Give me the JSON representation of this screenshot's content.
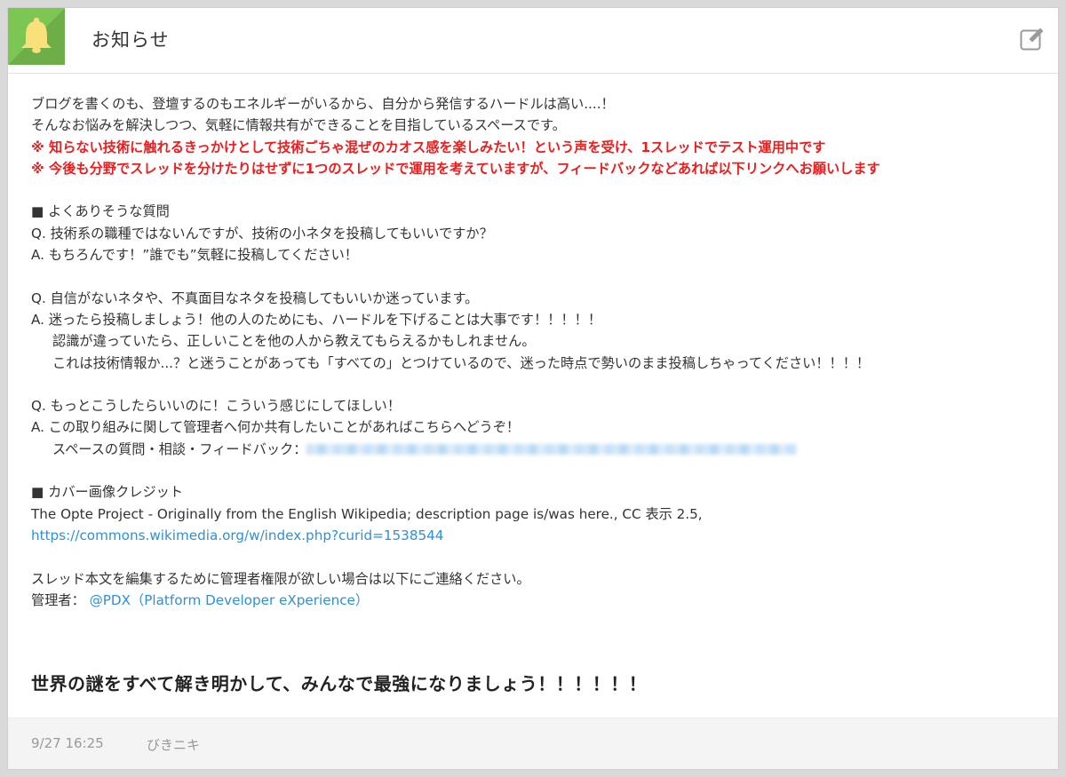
{
  "header": {
    "icon": "bell-icon",
    "accent_color": "#7cc653",
    "title": "お知らせ",
    "edit_icon": "edit-icon"
  },
  "body": {
    "intro_1": "ブログを書くのも、登壇するのもエネルギーがいるから、自分から発信するハードルは高い....！",
    "intro_2": "そんなお悩みを解決しつつ、気軽に情報共有ができることを目指しているスペースです。",
    "notice_1": "※ 知らない技術に触れるきっかけとして技術ごちゃ混ぜのカオス感を楽しみたい！という声を受け、1スレッドでテスト運用中です",
    "notice_2": "※ 今後も分野でスレッドを分けたりはせずに1つのスレッドで運用を考えていますが、フィードバックなどあれば以下リンクへお願いします",
    "faq_heading": "■ よくありそうな質問",
    "q1": "Q. 技術系の職種ではないんですが、技術の小ネタを投稿してもいいですか？",
    "a1": "A. もちろんです！”誰でも”気軽に投稿してください！",
    "q2": "Q. 自信がないネタや、不真面目なネタを投稿してもいいか迷っています。",
    "a2": "A. 迷ったら投稿しましょう！他の人のためにも、ハードルを下げることは大事です！！！！！",
    "a2_cont_1": "認識が違っていたら、正しいことを他の人から教えてもらえるかもしれません。",
    "a2_cont_2": "これは技術情報か...？と迷うことがあっても「すべての」とつけているので、迷った時点で勢いのまま投稿しちゃってください！！！！",
    "q3": "Q. もっとこうしたらいいのに！こういう感じにしてほしい！",
    "a3": "A. この取り組みに関して管理者へ何か共有したいことがあればこちらへどうぞ！",
    "a3_feedback_label": "スペースの質問・相談・フィードバック：",
    "credit_heading": "■ カバー画像クレジット",
    "credit_text": "The Opte Project - Originally from the English Wikipedia; description page is/was here., CC 表示 2.5,",
    "credit_link": "https://commons.wikimedia.org/w/index.php?curid=1538544",
    "admin_request": "スレッド本文を編集するために管理者権限が欲しい場合は以下にご連絡ください。",
    "admin_label": "管理者：",
    "admin_link": "@PDX（Platform Developer eXperience）",
    "closing": "世界の謎をすべて解き明かして、みんなで最強になりましょう！！！！！！"
  },
  "footer": {
    "timestamp": "9/27 16:25",
    "author": "びきニキ"
  },
  "colors": {
    "notice": "#ee1c1c",
    "link": "#2f8fd8"
  }
}
